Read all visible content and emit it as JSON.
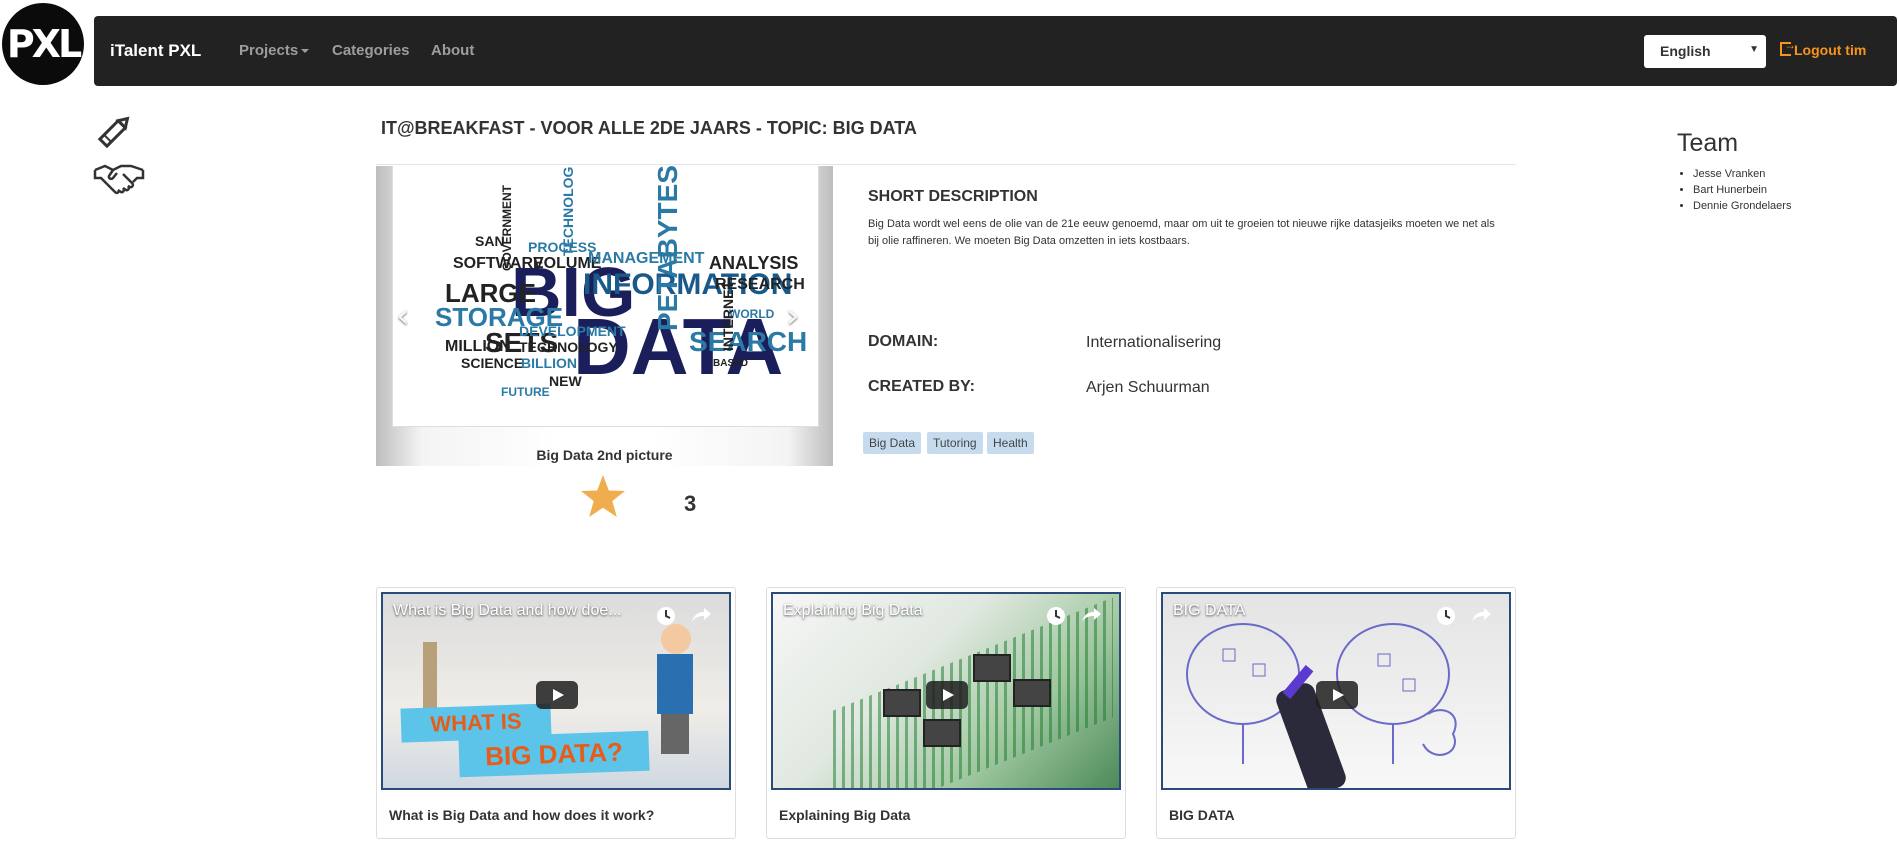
{
  "logo": {
    "text": "PXL"
  },
  "navbar": {
    "brand": "iTalent PXL",
    "items": [
      {
        "label": "Projects",
        "has_caret": true
      },
      {
        "label": "Categories"
      },
      {
        "label": "About"
      }
    ],
    "language": {
      "selected": "English"
    },
    "logout_label": "Logout tim"
  },
  "side_icons": [
    "pencil-icon",
    "handshake-icon"
  ],
  "project": {
    "title": "IT@BREAKFAST - VOOR ALLE 2DE JAARS - TOPIC: BIG DATA",
    "carousel": {
      "caption": "Big Data 2nd picture"
    },
    "rating": "3",
    "short_description_heading": "SHORT DESCRIPTION",
    "short_description": "Big Data wordt wel eens de olie van de 21e eeuw genoemd, maar om uit te groeien tot nieuwe rijke datasjeiks moeten we net als bij olie raffineren. We moeten Big Data omzetten in iets kostbaars.",
    "domain_label": "DOMAIN:",
    "domain": "Internationalisering",
    "created_by_label": "CREATED BY:",
    "created_by": "Arjen Schuurman",
    "tags": [
      "Big Data",
      "Tutoring",
      "Health"
    ]
  },
  "team": {
    "heading": "Team",
    "members": [
      "Jesse Vranken",
      "Bart Hunerbein",
      "Dennie Grondelaers"
    ]
  },
  "videos": [
    {
      "overlay_title": "What is Big Data and how doe...",
      "title": "What is Big Data and how does it work?",
      "thumb_text_1": "WHAT IS",
      "thumb_text_2": "BIG DATA?"
    },
    {
      "overlay_title": "Explaining Big Data",
      "title": "Explaining Big Data"
    },
    {
      "overlay_title": "BIG DATA",
      "title": "BIG DATA"
    }
  ],
  "colors": {
    "navbar": "#222222",
    "accent": "#f7941d",
    "tag_bg": "#c7dbee",
    "star": "#f0ad4e"
  }
}
